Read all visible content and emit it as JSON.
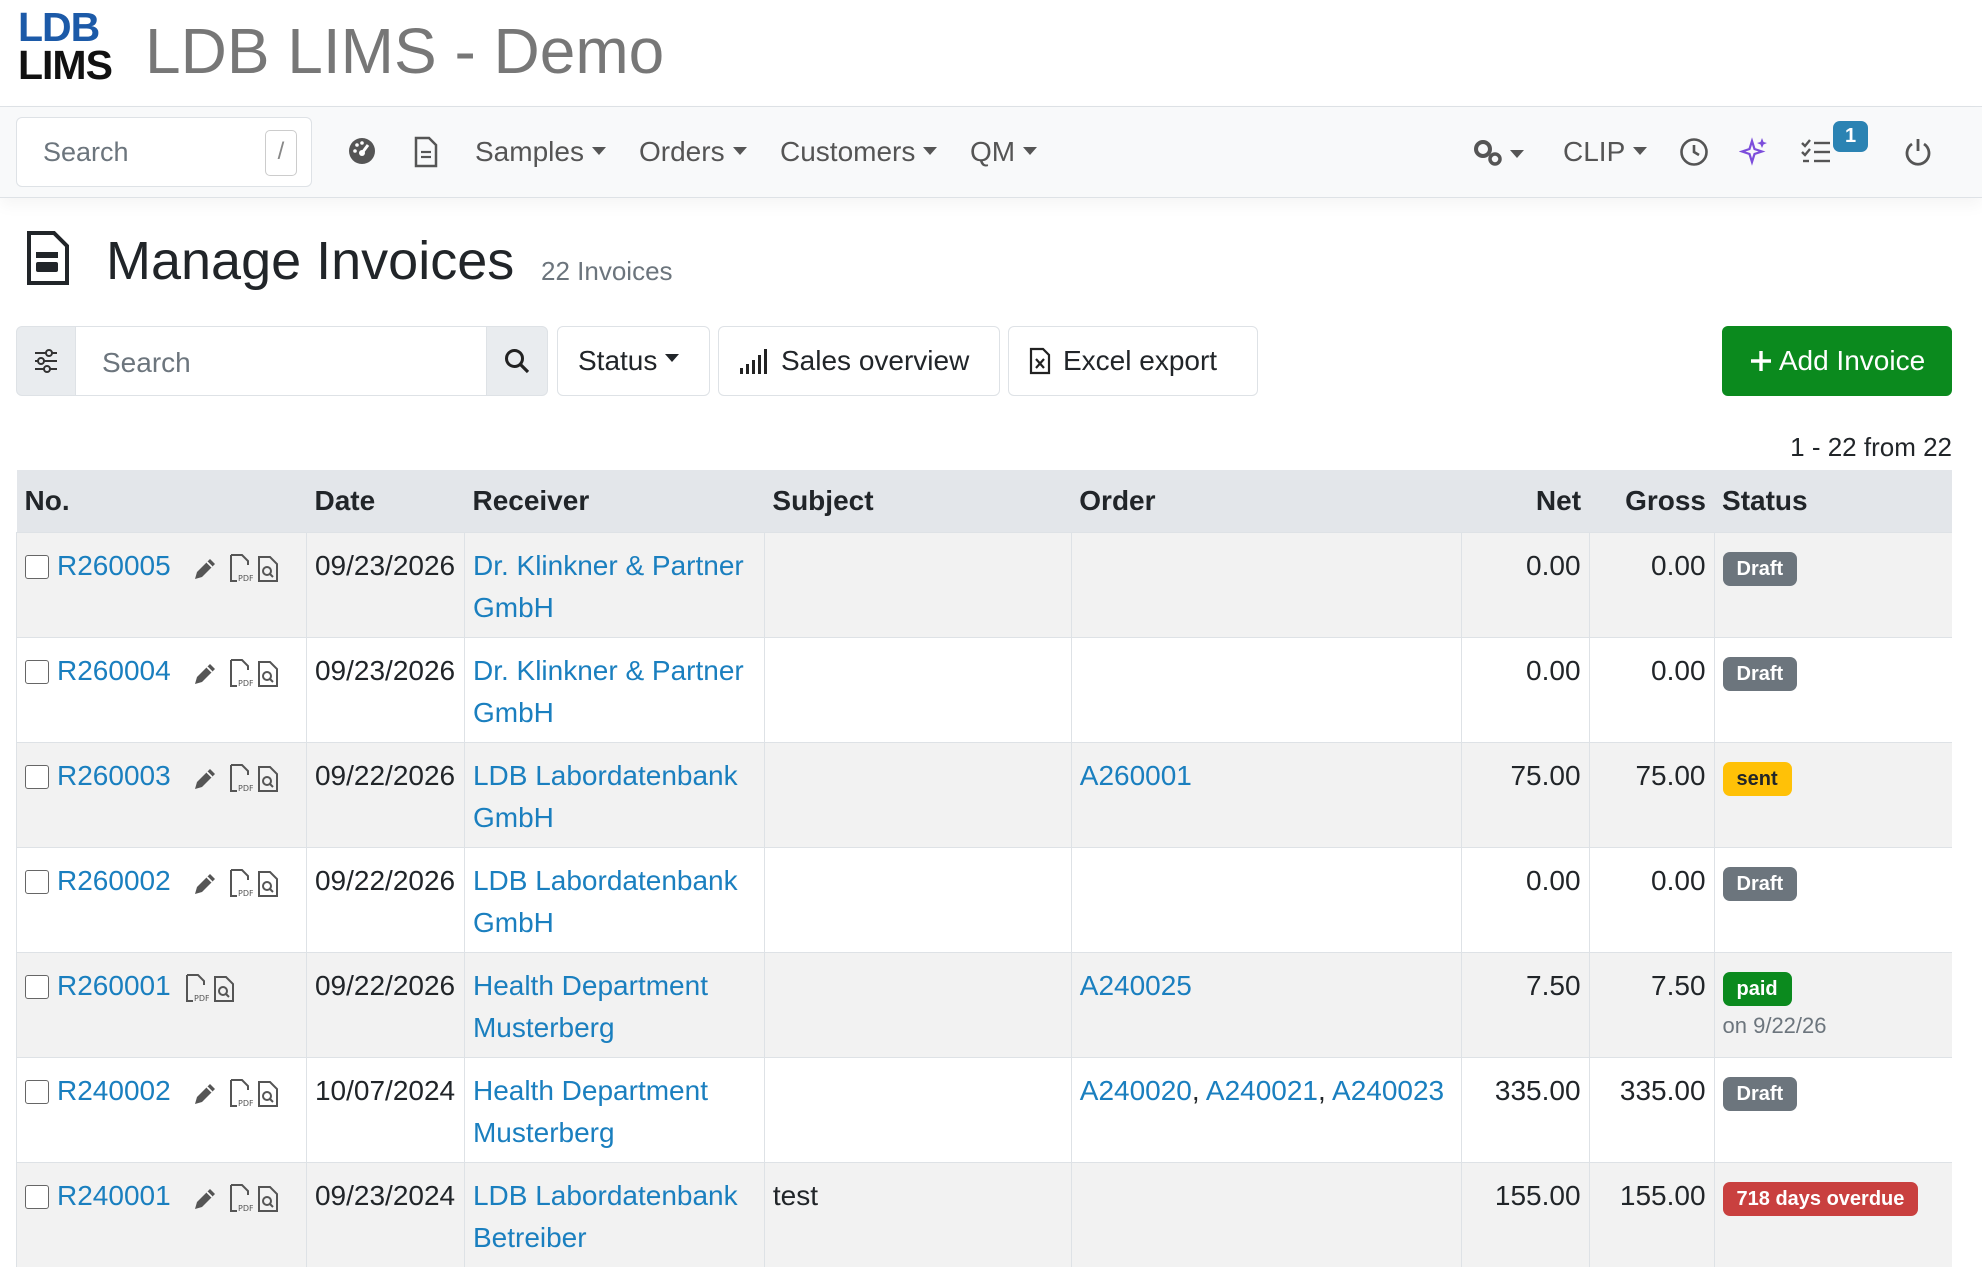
{
  "app": {
    "logo_line1": "LDB",
    "logo_line2": "LIMS",
    "title": "LDB LIMS - Demo"
  },
  "nav": {
    "search_placeholder": "Search",
    "shortcut_key": "/",
    "menus": [
      "Samples",
      "Orders",
      "Customers",
      "QM"
    ],
    "clip_label": "CLIP",
    "tasks_badge": "1"
  },
  "page": {
    "title": "Manage Invoices",
    "count": "22 Invoices"
  },
  "toolbar": {
    "search_placeholder": "Search",
    "status_label": "Status",
    "sales_label": "Sales overview",
    "excel_label": "Excel export",
    "add_label": "Add Invoice"
  },
  "pager": "1 - 22 from 22",
  "table": {
    "headers": {
      "no": "No.",
      "date": "Date",
      "receiver": "Receiver",
      "subject": "Subject",
      "order": "Order",
      "net": "Net",
      "gross": "Gross",
      "status": "Status"
    },
    "rows": [
      {
        "no": "R260005",
        "editable": true,
        "date": "09/23/2026",
        "receiver": "Dr. Klinkner & Partner GmbH",
        "subject": "",
        "orders": [],
        "net": "0.00",
        "gross": "0.00",
        "status": "Draft",
        "status_type": "draft",
        "status_note": ""
      },
      {
        "no": "R260004",
        "editable": true,
        "date": "09/23/2026",
        "receiver": "Dr. Klinkner & Partner GmbH",
        "subject": "",
        "orders": [],
        "net": "0.00",
        "gross": "0.00",
        "status": "Draft",
        "status_type": "draft",
        "status_note": ""
      },
      {
        "no": "R260003",
        "editable": true,
        "date": "09/22/2026",
        "receiver": "LDB Labordatenbank GmbH",
        "subject": "",
        "orders": [
          "A260001"
        ],
        "net": "75.00",
        "gross": "75.00",
        "status": "sent",
        "status_type": "sent",
        "status_note": ""
      },
      {
        "no": "R260002",
        "editable": true,
        "date": "09/22/2026",
        "receiver": "LDB Labordatenbank GmbH",
        "subject": "",
        "orders": [],
        "net": "0.00",
        "gross": "0.00",
        "status": "Draft",
        "status_type": "draft",
        "status_note": ""
      },
      {
        "no": "R260001",
        "editable": false,
        "date": "09/22/2026",
        "receiver": "Health Department Musterberg",
        "subject": "",
        "orders": [
          "A240025"
        ],
        "net": "7.50",
        "gross": "7.50",
        "status": "paid",
        "status_type": "paid",
        "status_note": "on 9/22/26"
      },
      {
        "no": "R240002",
        "editable": true,
        "date": "10/07/2024",
        "receiver": "Health Department Musterberg",
        "subject": "",
        "orders": [
          "A240020",
          "A240021",
          "A240023"
        ],
        "net": "335.00",
        "gross": "335.00",
        "status": "Draft",
        "status_type": "draft",
        "status_note": ""
      },
      {
        "no": "R240001",
        "editable": true,
        "date": "09/23/2024",
        "receiver": "LDB Labordatenbank Betreiber",
        "subject": "test",
        "orders": [],
        "net": "155.00",
        "gross": "155.00",
        "status": "718 days overdue",
        "status_type": "overdue",
        "status_note": ""
      }
    ]
  },
  "colors": {
    "link": "#1a7fbf",
    "success": "#0b8a1e",
    "draft": "#6c757d",
    "sent": "#ffc107",
    "overdue": "#c9403f",
    "badge": "#2b83b3"
  }
}
